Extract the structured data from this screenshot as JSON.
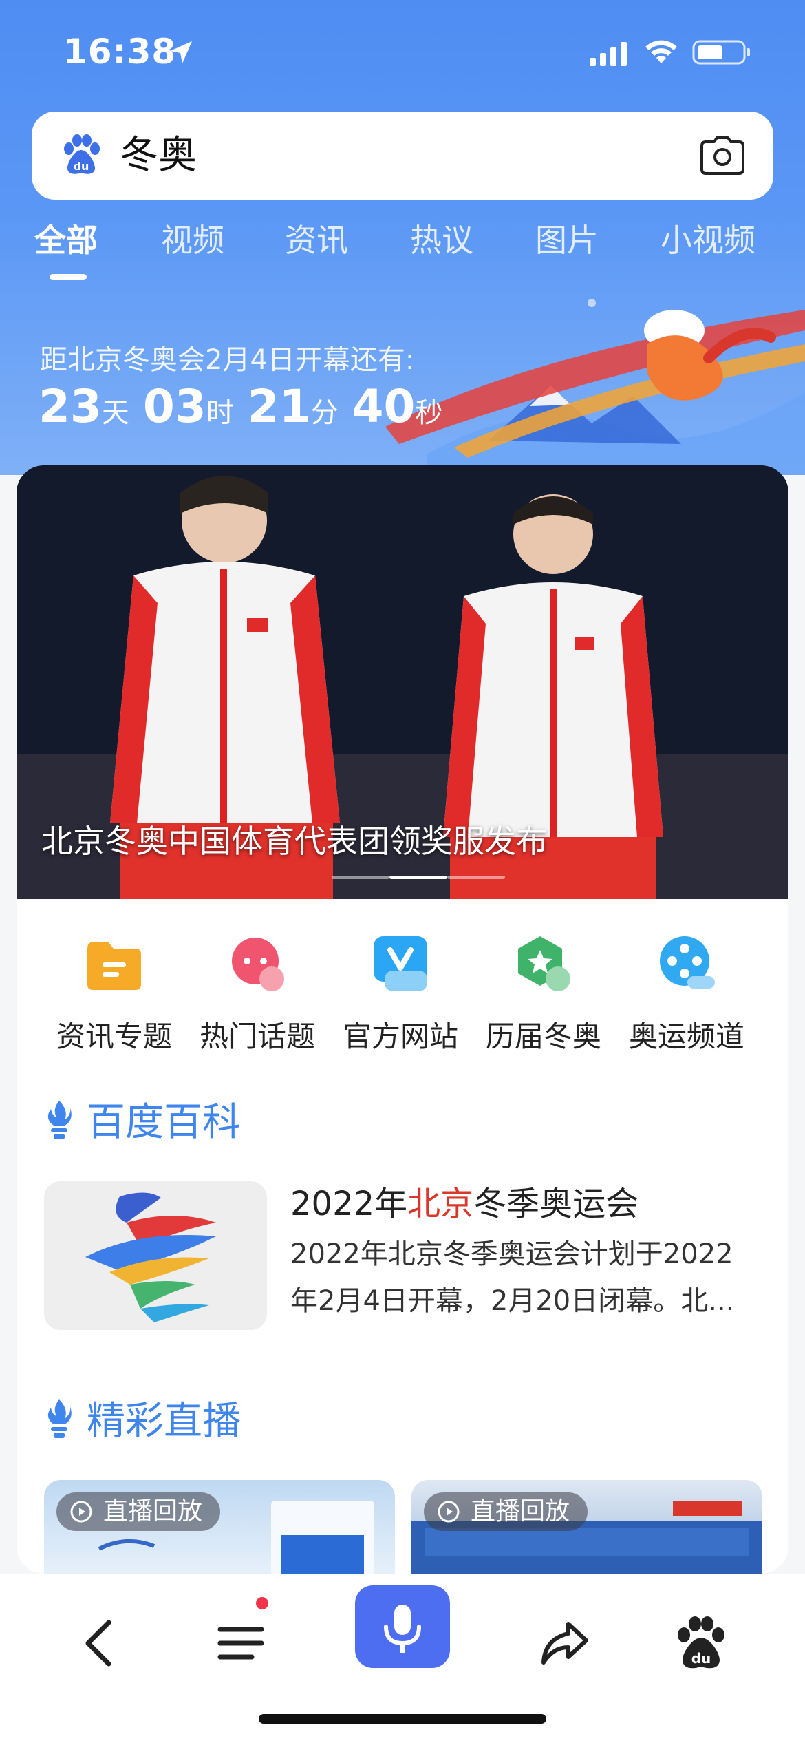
{
  "status_bar": {
    "time": "16:38"
  },
  "search": {
    "query": "冬奥"
  },
  "tabs": [
    {
      "label": "全部"
    },
    {
      "label": "视频"
    },
    {
      "label": "资讯"
    },
    {
      "label": "热议"
    },
    {
      "label": "图片"
    },
    {
      "label": "小视频"
    }
  ],
  "countdown": {
    "label": "距北京冬奥会2月4日开幕还有:",
    "days": "23",
    "days_unit": "天",
    "hours": "03",
    "hours_unit": "时",
    "minutes": "21",
    "minutes_unit": "分",
    "seconds": "40",
    "seconds_unit": "秒"
  },
  "banner": {
    "caption": "北京冬奥中国体育代表团领奖服发布",
    "slide_count": 3,
    "active_slide": 2
  },
  "shortcuts": [
    {
      "label": "资讯专题",
      "icon": "folder-icon",
      "color": "#f7a928"
    },
    {
      "label": "热门话题",
      "icon": "chat-icon",
      "color": "#f0546e"
    },
    {
      "label": "官方网站",
      "icon": "v-badge-icon",
      "color": "#2aa6f4"
    },
    {
      "label": "历届冬奥",
      "icon": "star-hexagon-icon",
      "color": "#3fb36a"
    },
    {
      "label": "奥运频道",
      "icon": "film-reel-icon",
      "color": "#31a8f2"
    }
  ],
  "baike": {
    "section_title": "百度百科",
    "title_pre": "2022年",
    "title_highlight": "北京",
    "title_post": "冬季奥运会",
    "description": "2022年北京冬季奥运会计划于2022年2月4日开幕，2月20日闭幕。北..."
  },
  "live": {
    "section_title": "精彩直播",
    "cards": [
      {
        "badge": "直播回放"
      },
      {
        "badge": "直播回放"
      }
    ]
  },
  "colors": {
    "brand_blue": "#4f8df3",
    "section_blue": "#3f85ee",
    "highlight_red": "#d9372b",
    "mic_blue": "#4e6ef2"
  }
}
